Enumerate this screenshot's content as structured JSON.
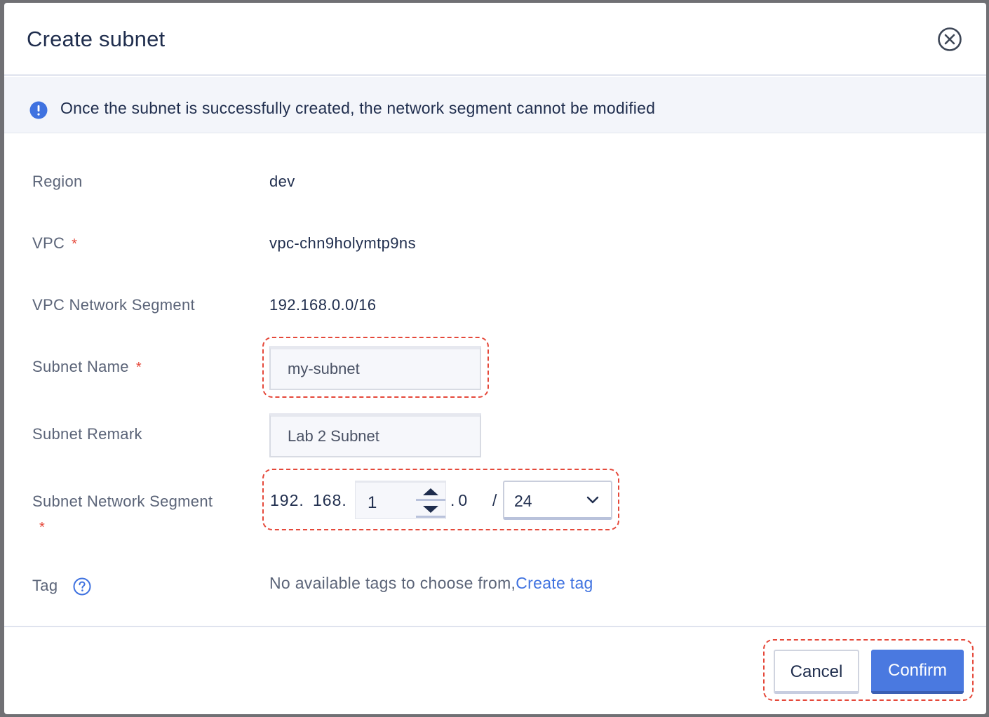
{
  "dialog": {
    "title": "Create subnet",
    "close_icon": "close-circle-icon"
  },
  "alert": {
    "icon": "info-icon",
    "text": "Once the subnet is successfully created, the network segment cannot be modified"
  },
  "form": {
    "region": {
      "label": "Region",
      "value": "dev"
    },
    "vpc": {
      "label": "VPC",
      "required_mark": "*",
      "value": "vpc-chn9holymtp9ns"
    },
    "vpc_segment": {
      "label": "VPC Network Segment",
      "value": "192.168.0.0/16"
    },
    "subnet_name": {
      "label": "Subnet Name",
      "required_mark": "*",
      "value": "my-subnet"
    },
    "subnet_remark": {
      "label": "Subnet Remark",
      "value": "Lab 2 Subnet"
    },
    "subnet_segment": {
      "label": "Subnet Network Segment",
      "required_mark": "*",
      "octet1": "192",
      "octet2": "168",
      "octet3": "1",
      "octet4": "0",
      "slash": "/",
      "prefix": "24",
      "dot": "."
    },
    "tag": {
      "label": "Tag",
      "help_icon": "question-circle-icon",
      "text": "No available tags to choose from,",
      "link": "Create tag"
    }
  },
  "footer": {
    "cancel_label": "Cancel",
    "confirm_label": "Confirm"
  },
  "colors": {
    "primary": "#4a79e0",
    "required": "#e5483a",
    "highlight_dash": "#e5483a",
    "title": "#1f2d4d"
  }
}
